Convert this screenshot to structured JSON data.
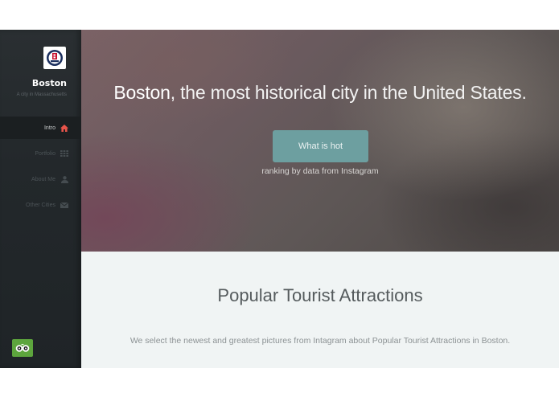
{
  "sidebar": {
    "city_name": "Boston",
    "city_subtitle": "A city in Massachusetts",
    "nav": [
      {
        "label": "Intro",
        "icon": "home-icon",
        "active": true
      },
      {
        "label": "Portfolio",
        "icon": "grid-icon",
        "active": false
      },
      {
        "label": "About Me",
        "icon": "user-icon",
        "active": false
      },
      {
        "label": "Other Cities",
        "icon": "envelope-icon",
        "active": false
      }
    ],
    "badge_icon": "tripadvisor-owl-icon"
  },
  "hero": {
    "title_strong": "Boston",
    "title_rest": ", the most historical city in the United States.",
    "button_label": "What is hot",
    "subtitle": "ranking by data from Instagram"
  },
  "section": {
    "title": "Popular Tourist Attractions",
    "text": "We select the newest and greatest pictures from Intagram about Popular Tourist Attractions in Boston."
  },
  "colors": {
    "sidebar_bg": "#23282b",
    "active_icon": "#e8544a",
    "button_bg": "#6d9fa0",
    "section_bg": "#f0f4f4",
    "badge_bg": "#5da53d"
  }
}
